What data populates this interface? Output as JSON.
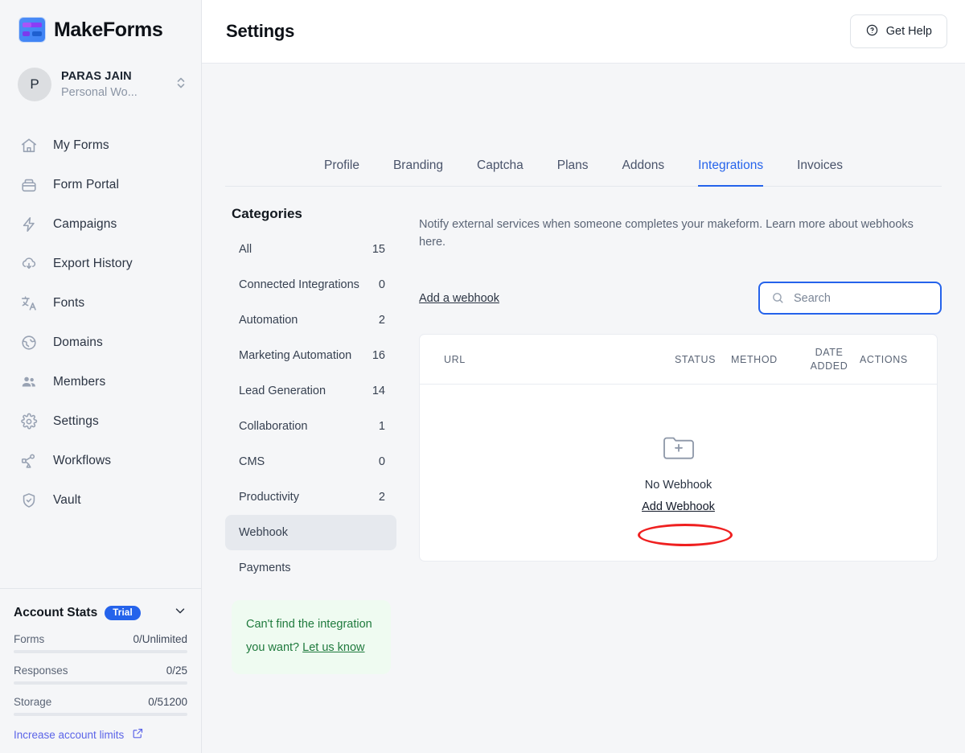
{
  "brand": {
    "name": "MakeForms",
    "logo_icon": "makeforms-logo-icon"
  },
  "workspace": {
    "avatar_initial": "P",
    "user_name": "PARAS JAIN",
    "workspace_name": "Personal Wo...",
    "switcher_icon": "chevron-updown-icon"
  },
  "sidebar": {
    "items": [
      {
        "label": "My Forms",
        "icon": "home-icon"
      },
      {
        "label": "Form Portal",
        "icon": "briefcase-icon"
      },
      {
        "label": "Campaigns",
        "icon": "bolt-icon"
      },
      {
        "label": "Export History",
        "icon": "cloud-download-icon"
      },
      {
        "label": "Fonts",
        "icon": "translate-icon"
      },
      {
        "label": "Domains",
        "icon": "globe-icon"
      },
      {
        "label": "Members",
        "icon": "users-icon"
      },
      {
        "label": "Settings",
        "icon": "gear-icon"
      },
      {
        "label": "Workflows",
        "icon": "workflow-icon"
      },
      {
        "label": "Vault",
        "icon": "shield-check-icon"
      }
    ]
  },
  "account_stats": {
    "title": "Account Stats",
    "badge": "Trial",
    "collapse_icon": "chevron-down-icon",
    "rows": [
      {
        "label": "Forms",
        "value": "0/Unlimited",
        "progress": 0
      },
      {
        "label": "Responses",
        "value": "0/25",
        "progress": 0
      },
      {
        "label": "Storage",
        "value": "0/51200",
        "progress": 0
      }
    ],
    "increase_link": "Increase account limits",
    "increase_icon": "external-link-icon"
  },
  "header": {
    "title": "Settings",
    "help_button": "Get Help",
    "help_icon": "question-circle-icon"
  },
  "tabs": [
    {
      "label": "Profile",
      "active": false
    },
    {
      "label": "Branding",
      "active": false
    },
    {
      "label": "Captcha",
      "active": false
    },
    {
      "label": "Plans",
      "active": false
    },
    {
      "label": "Addons",
      "active": false
    },
    {
      "label": "Integrations",
      "active": true
    },
    {
      "label": "Invoices",
      "active": false
    }
  ],
  "categories": {
    "title": "Categories",
    "items": [
      {
        "name": "All",
        "count": "15",
        "active": false
      },
      {
        "name": "Connected Integrations",
        "count": "0",
        "active": false
      },
      {
        "name": "Automation",
        "count": "2",
        "active": false
      },
      {
        "name": "Marketing Automation",
        "count": "16",
        "active": false
      },
      {
        "name": "Lead Generation",
        "count": "14",
        "active": false
      },
      {
        "name": "Collaboration",
        "count": "1",
        "active": false
      },
      {
        "name": "CMS",
        "count": "0",
        "active": false
      },
      {
        "name": "Productivity",
        "count": "2",
        "active": false
      },
      {
        "name": "Webhook",
        "count": "",
        "active": true
      },
      {
        "name": "Payments",
        "count": "",
        "active": false
      }
    ]
  },
  "promo": {
    "text": "Can't find the integration you want? ",
    "link": "Let us know"
  },
  "webhook_panel": {
    "description": "Notify external services when someone completes your makeform. Learn more about webhooks here.",
    "add_link": "Add a webhook",
    "search": {
      "placeholder": "Search",
      "value": "",
      "icon": "search-icon"
    },
    "table": {
      "columns": [
        "URL",
        "STATUS",
        "METHOD",
        "DATE ADDED",
        "ACTIONS"
      ],
      "date_added_line1": "DATE",
      "date_added_line2": "ADDED",
      "rows": []
    },
    "empty_state": {
      "icon": "folder-plus-icon",
      "title": "No Webhook",
      "action": "Add Webhook"
    }
  },
  "annotation": {
    "type": "highlight-oval",
    "color": "#ef2020",
    "target": "Add Webhook"
  }
}
